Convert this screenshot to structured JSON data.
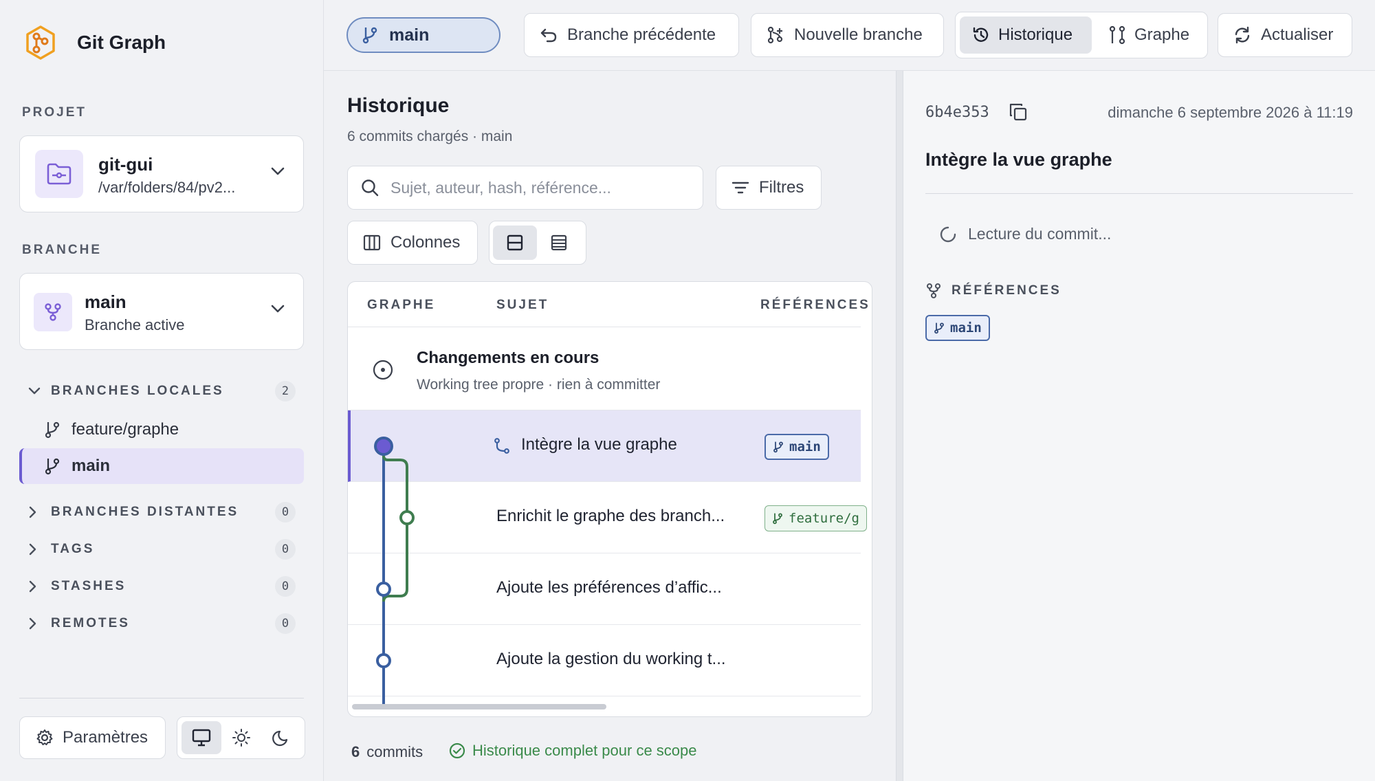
{
  "app": {
    "title": "Git Graph"
  },
  "sidebar": {
    "project_label": "PROJET",
    "project": {
      "name": "git-gui",
      "path": "/var/folders/84/pv2..."
    },
    "branch_label": "BRANCHE",
    "branch": {
      "name": "main",
      "sub": "Branche active"
    },
    "sections": [
      {
        "label": "BRANCHES LOCALES",
        "count": "2",
        "expanded": true
      },
      {
        "label": "BRANCHES DISTANTES",
        "count": "0",
        "expanded": false
      },
      {
        "label": "TAGS",
        "count": "0",
        "expanded": false
      },
      {
        "label": "STASHES",
        "count": "0",
        "expanded": false
      },
      {
        "label": "REMOTES",
        "count": "0",
        "expanded": false
      }
    ],
    "local_branches": [
      {
        "name": "feature/graphe",
        "active": false
      },
      {
        "name": "main",
        "active": true
      }
    ],
    "settings_label": "Paramètres",
    "theme_active": "system"
  },
  "toolbar": {
    "current_branch": "main",
    "previous_branch": "Branche précédente",
    "new_branch": "Nouvelle branche",
    "history": "Historique",
    "graph": "Graphe",
    "refresh": "Actualiser",
    "active_view": "Historique"
  },
  "history": {
    "title": "Historique",
    "subtitle": "6 commits chargés · main",
    "search_placeholder": "Sujet, auteur, hash, référence...",
    "filters_label": "Filtres",
    "columns_label": "Colonnes",
    "columns": [
      "GRAPHE",
      "SUJET",
      "RÉFÉRENCES"
    ],
    "wip": {
      "title": "Changements en cours",
      "subtitle": "Working tree propre · rien à committer"
    },
    "commits": [
      {
        "subject": "Intègre la vue graphe",
        "ref": "main",
        "ref_kind": "local",
        "selected": true,
        "merge": true
      },
      {
        "subject": "Enrichit le graphe des branch...",
        "ref": "feature/g",
        "ref_kind": "feature",
        "selected": false,
        "merge": false
      },
      {
        "subject": "Ajoute les préférences d’affic...",
        "ref": "",
        "selected": false,
        "merge": false
      },
      {
        "subject": "Ajoute la gestion du working t...",
        "ref": "",
        "selected": false,
        "merge": false
      }
    ],
    "footer": {
      "count": "6",
      "count_label": "commits",
      "status": "Historique complet pour ce scope"
    }
  },
  "detail": {
    "hash": "6b4e353",
    "date": "dimanche 6 septembre 2026 à 11:19",
    "title": "Intègre la vue graphe",
    "loading": "Lecture du commit...",
    "refs_label": "RÉFÉRENCES",
    "refs": [
      "main"
    ]
  },
  "colors": {
    "accent": "#6b5bd1",
    "main_lane": "#3a5fa0",
    "feature_lane": "#3f7d4f",
    "success": "#3a8a4a"
  }
}
